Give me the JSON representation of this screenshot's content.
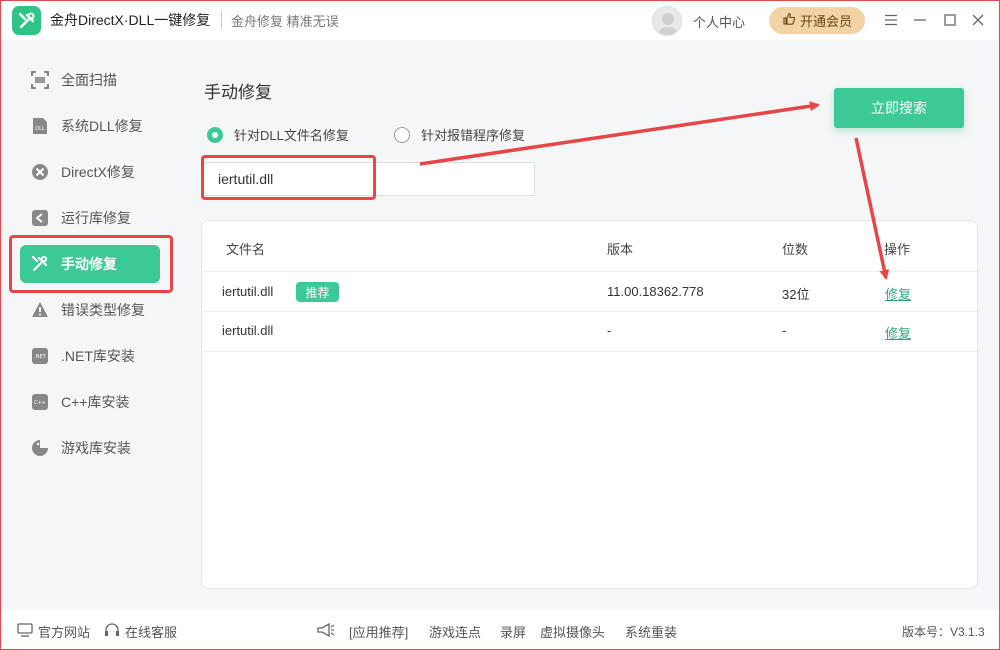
{
  "app": {
    "title": "金舟DirectX·DLL一键修复",
    "slogan": "金舟修复 精准无误",
    "user_center": "个人中心",
    "vip_label": "开通会员"
  },
  "sidebar": {
    "items": [
      {
        "label": "全面扫描",
        "icon": "scan-icon"
      },
      {
        "label": "系统DLL修复",
        "icon": "dll-icon"
      },
      {
        "label": "DirectX修复",
        "icon": "directx-icon"
      },
      {
        "label": "运行库修复",
        "icon": "runtime-icon"
      },
      {
        "label": "手动修复",
        "icon": "wrench-icon",
        "active": true
      },
      {
        "label": "错误类型修复",
        "icon": "warning-icon"
      },
      {
        "label": ".NET库安装",
        "icon": "net-icon"
      },
      {
        "label": "C++库安装",
        "icon": "cpp-icon"
      },
      {
        "label": "游戏库安装",
        "icon": "game-icon"
      }
    ]
  },
  "main": {
    "title": "手动修复",
    "radio_options": [
      {
        "label": "针对DLL文件名修复",
        "checked": true
      },
      {
        "label": "针对报错程序修复",
        "checked": false
      }
    ],
    "search_value": "iertutil.dll",
    "search_button": "立即搜索",
    "table": {
      "headers": [
        "文件名",
        "版本",
        "位数",
        "操作"
      ],
      "rows": [
        {
          "file": "iertutil.dll",
          "badge": "推荐",
          "version": "11.00.18362.778",
          "bits": "32位",
          "action": "修复"
        },
        {
          "file": "iertutil.dll",
          "badge": "",
          "version": "-",
          "bits": "-",
          "action": "修复"
        }
      ]
    }
  },
  "footer": {
    "official_site": "官方网站",
    "online_service": "在线客服",
    "recommend": "[应用推荐]",
    "links": [
      "游戏连点",
      "录屏",
      "虚拟摄像头",
      "系统重装"
    ],
    "version": "版本号：V3.1.3"
  },
  "colors": {
    "accent": "#3dc996",
    "annotation_red": "#e84646",
    "vip_bg": "#f2d3a6"
  }
}
